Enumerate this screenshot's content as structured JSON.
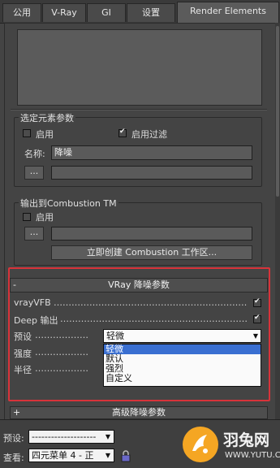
{
  "tabs": [
    "公用",
    "V-Ray",
    "GI",
    "设置",
    "Render Elements"
  ],
  "selected_params": {
    "title": "选定元素参数",
    "enable_label": "启用",
    "enable_filter_label": "启用过滤",
    "name_label": "名称:",
    "name_value": "降噪",
    "browse_label": "..."
  },
  "combustion": {
    "title": "输出到Combustion   TM",
    "enable_label": "启用",
    "browse_label": "...",
    "create_button": "立即创建 Combustion 工作区..."
  },
  "vray_denoise": {
    "minus": "-",
    "title": "VRay 降噪参数",
    "rows": [
      {
        "label": "vrayVFB",
        "dots": "…………………………………………………………………………"
      },
      {
        "label": "Deep 输出",
        "dots": "…………………………………………………………………………"
      },
      {
        "label": "预设",
        "dots": "………………"
      },
      {
        "label": "强度",
        "dots": "………………"
      },
      {
        "label": "半径",
        "dots": "………………"
      }
    ],
    "preset_value": "轻微",
    "options": [
      "轻微",
      "默认",
      "强烈",
      "自定义"
    ],
    "selected_option": "轻微"
  },
  "advanced": {
    "plus": "+",
    "title": "高级降噪参数"
  },
  "bottom": {
    "preset_label": "预设:",
    "preset_value": "--------------------",
    "view_label": "查看:",
    "view_value": "四元菜单 4 - 正"
  },
  "watermark": {
    "brand": "羽兔网",
    "url": "WWW.YUTU.CN"
  },
  "colors": {
    "highlight": "#d8333a",
    "selection": "#3a6fd1",
    "watermark": "#f5a623"
  }
}
